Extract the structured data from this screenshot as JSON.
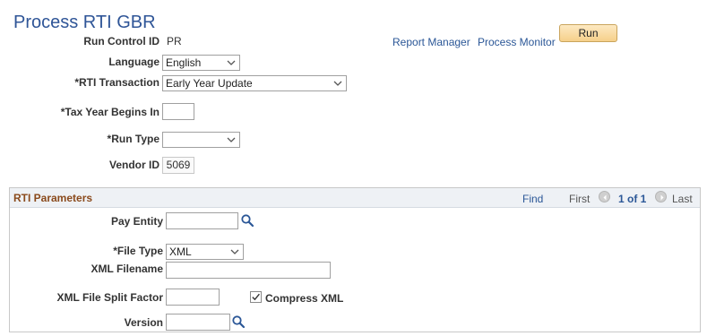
{
  "page": {
    "title": "Process RTI GBR"
  },
  "header": {
    "run_control_label": "Run Control ID",
    "run_control_value": "PR",
    "report_manager": "Report Manager",
    "process_monitor": "Process Monitor",
    "run_button": "Run"
  },
  "form": {
    "language_label": "Language",
    "language_value": "English",
    "rti_transaction_label": "*RTI Transaction",
    "rti_transaction_value": "Early Year Update",
    "tax_year_label": "*Tax Year Begins In",
    "tax_year_value": "",
    "run_type_label": "*Run Type",
    "run_type_value": "",
    "vendor_id_label": "Vendor ID",
    "vendor_id_value": "5069"
  },
  "rti_parameters": {
    "title": "RTI Parameters",
    "find": "Find",
    "first": "First",
    "counter": "1 of 1",
    "last": "Last",
    "pay_entity_label": "Pay Entity",
    "pay_entity_value": "",
    "file_type_label": "*File Type",
    "file_type_value": "XML",
    "xml_filename_label": "XML Filename",
    "xml_filename_value": "",
    "split_factor_label": "XML File Split Factor",
    "split_factor_value": "",
    "compress_label": "Compress XML",
    "compress_checked": true,
    "version_label": "Version",
    "version_value": ""
  },
  "icons": {
    "dropdown": "chevron-down-icon",
    "lookup": "magnifier-icon",
    "prev": "previous-arrow-icon",
    "next": "next-arrow-icon",
    "check": "checkmark-icon"
  }
}
